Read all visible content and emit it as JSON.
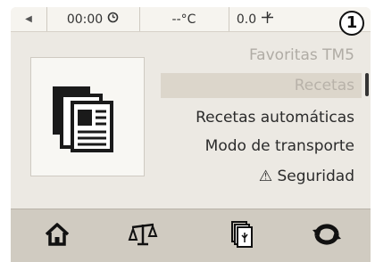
{
  "status_bar": {
    "timer": "00:00",
    "temperature": "--°C",
    "speed": "0.0",
    "step_badge": "1"
  },
  "menu": {
    "items": [
      {
        "label": "Favoritas TM5",
        "state": "faded"
      },
      {
        "label": "Recetas",
        "state": "selected"
      },
      {
        "label": "Recetas automáticas",
        "state": "normal"
      },
      {
        "label": "Modo de transporte",
        "state": "normal"
      },
      {
        "label": "⚠ Seguridad",
        "state": "normal"
      }
    ]
  },
  "bottom_nav": [
    "home-icon",
    "scale-icon",
    "recipe-book-icon",
    "turbo-icon"
  ],
  "colors": {
    "background": "#ece9e3",
    "bottom_bar": "#d0cbc1",
    "selected_row": "#dcd6cb",
    "text": "#2b2b2b",
    "faded_text": "#b0aca5"
  }
}
